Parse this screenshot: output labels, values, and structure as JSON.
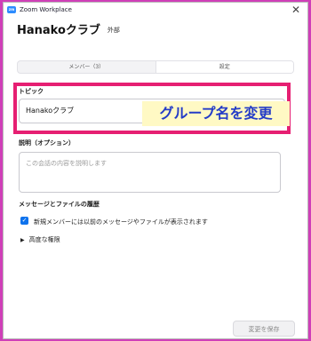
{
  "window": {
    "title": "Zoom Workplace",
    "logo": "zm",
    "close_icon": "✕"
  },
  "header": {
    "name": "Hanakoクラブ",
    "tag": "外部"
  },
  "tabs": [
    {
      "label": "メンバー（3）"
    },
    {
      "label": "設定"
    }
  ],
  "topic": {
    "label": "トピック",
    "value": "Hanakoクラブ",
    "overlay": "グループ名を変更"
  },
  "description": {
    "label": "説明（オプション）",
    "placeholder": "この会話の内容を説明します"
  },
  "history": {
    "label": "メッセージとファイルの履歴",
    "checkbox_label": "新規メンバーには以前のメッセージやファイルが表示されます",
    "checked": true
  },
  "advanced": {
    "label": "高度な権限"
  },
  "footer": {
    "save_label": "変更を保存"
  },
  "colors": {
    "highlight": "#e61f72",
    "overlay_text": "#243cc7",
    "checkbox": "#0e72ed"
  }
}
